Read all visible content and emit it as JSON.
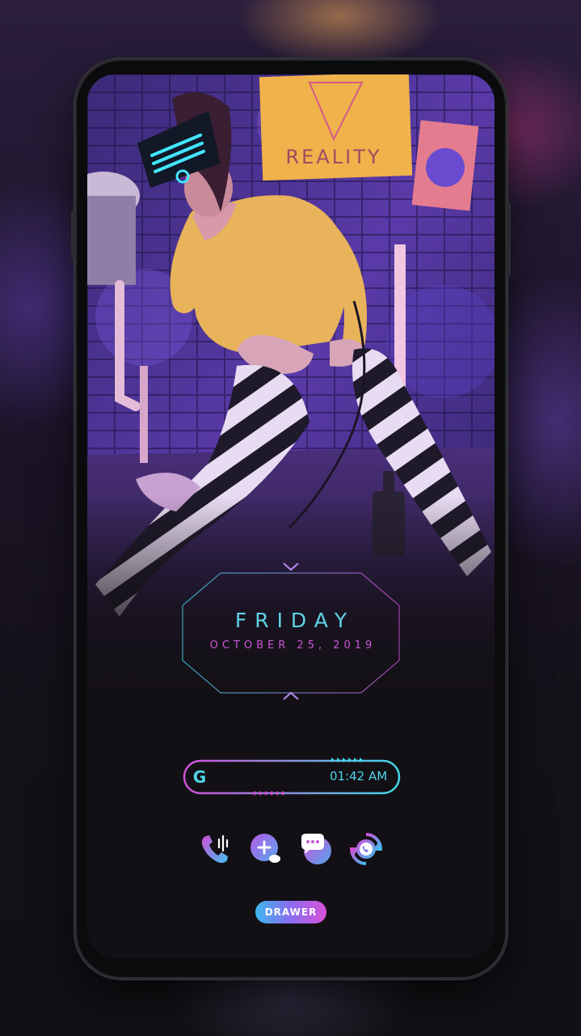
{
  "colors": {
    "accent_cyan": "#4fd3e8",
    "accent_magenta": "#d04fd6",
    "screen_bg": "#131015"
  },
  "wallpaper": {
    "sign_text": "REALITY"
  },
  "widget": {
    "day": "FRIDAY",
    "date": "OCTOBER 25, 2019"
  },
  "search_bar": {
    "logo": "G",
    "time": "01:42 AM"
  },
  "dock": {
    "apps": [
      {
        "icon": "phone-dialer-icon"
      },
      {
        "icon": "messenger-plus-icon"
      },
      {
        "icon": "sms-chat-icon"
      },
      {
        "icon": "whatsapp-sync-icon"
      }
    ]
  },
  "drawer": {
    "label": "DRAWER"
  }
}
